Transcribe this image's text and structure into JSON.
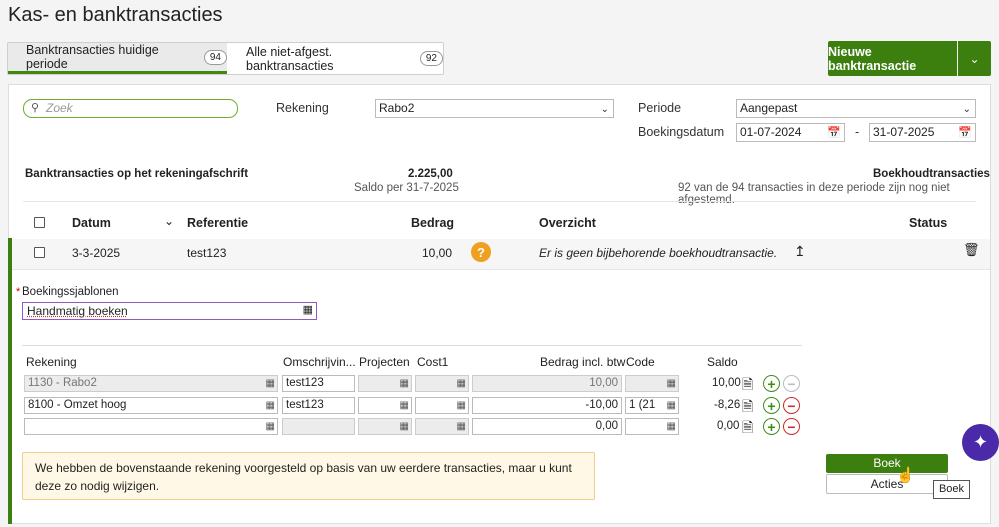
{
  "page_title": "Kas- en banktransacties",
  "tabs": [
    {
      "label": "Banktransacties huidige periode",
      "count": "94"
    },
    {
      "label": "Alle niet-afgest. banktransacties",
      "count": "92"
    }
  ],
  "new_button": "Nieuwe banktransactie",
  "search": {
    "placeholder": "Zoek"
  },
  "filters": {
    "rekening_label": "Rekening",
    "rekening_value": "Rabo2",
    "periode_label": "Periode",
    "periode_value": "Aangepast",
    "boekingsdatum_label": "Boekingsdatum",
    "date_from": "01-07-2024",
    "date_sep": "-",
    "date_to": "31-07-2025"
  },
  "summary": {
    "left_title": "Banktransacties op het rekeningafschrift",
    "amount": "2.225,00",
    "saldo": "Saldo per 31-7-2025",
    "right_title": "Boekhoudtransacties",
    "right_sub": "92 van de 94 transacties in deze periode zijn nog niet afgestemd."
  },
  "columns": {
    "datum": "Datum",
    "referentie": "Referentie",
    "bedrag": "Bedrag",
    "overzicht": "Overzicht",
    "status": "Status"
  },
  "row": {
    "datum": "3-3-2025",
    "referentie": "test123",
    "bedrag": "10,00",
    "overzicht": "Er is geen bijbehorende boekhoudtransactie."
  },
  "template": {
    "label": "Boekingssjablonen",
    "required": "*",
    "value": "Handmatig boeken"
  },
  "lines_header": {
    "rekening": "Rekening",
    "omschrijving": "Omschrijvin...",
    "projecten": "Projecten",
    "cost1": "Cost1",
    "bedrag": "Bedrag incl. btw",
    "code": "Code",
    "saldo": "Saldo"
  },
  "lines": [
    {
      "rekening": "1130 - Rabo2",
      "omschrijving": "test123",
      "bedrag": "10,00",
      "code": "",
      "saldo": "10,00"
    },
    {
      "rekening": "8100 - Omzet hoog",
      "omschrijving": "test123",
      "bedrag": "-10,00",
      "code": "1 (21",
      "saldo": "-8,26"
    },
    {
      "rekening": "",
      "omschrijving": "",
      "bedrag": "0,00",
      "code": "",
      "saldo": "0,00"
    }
  ],
  "note": "We hebben de bovenstaande rekening voorgesteld op basis van uw eerdere transacties, maar u kunt deze zo nodig wijzigen.",
  "buttons": {
    "boek": "Boek",
    "acties": "Acties",
    "tooltip": "Boek"
  },
  "colors": {
    "accent": "#3c7f0f",
    "warning": "#f0a020",
    "danger": "#cc2a2a",
    "ai": "#4a2aa8"
  }
}
